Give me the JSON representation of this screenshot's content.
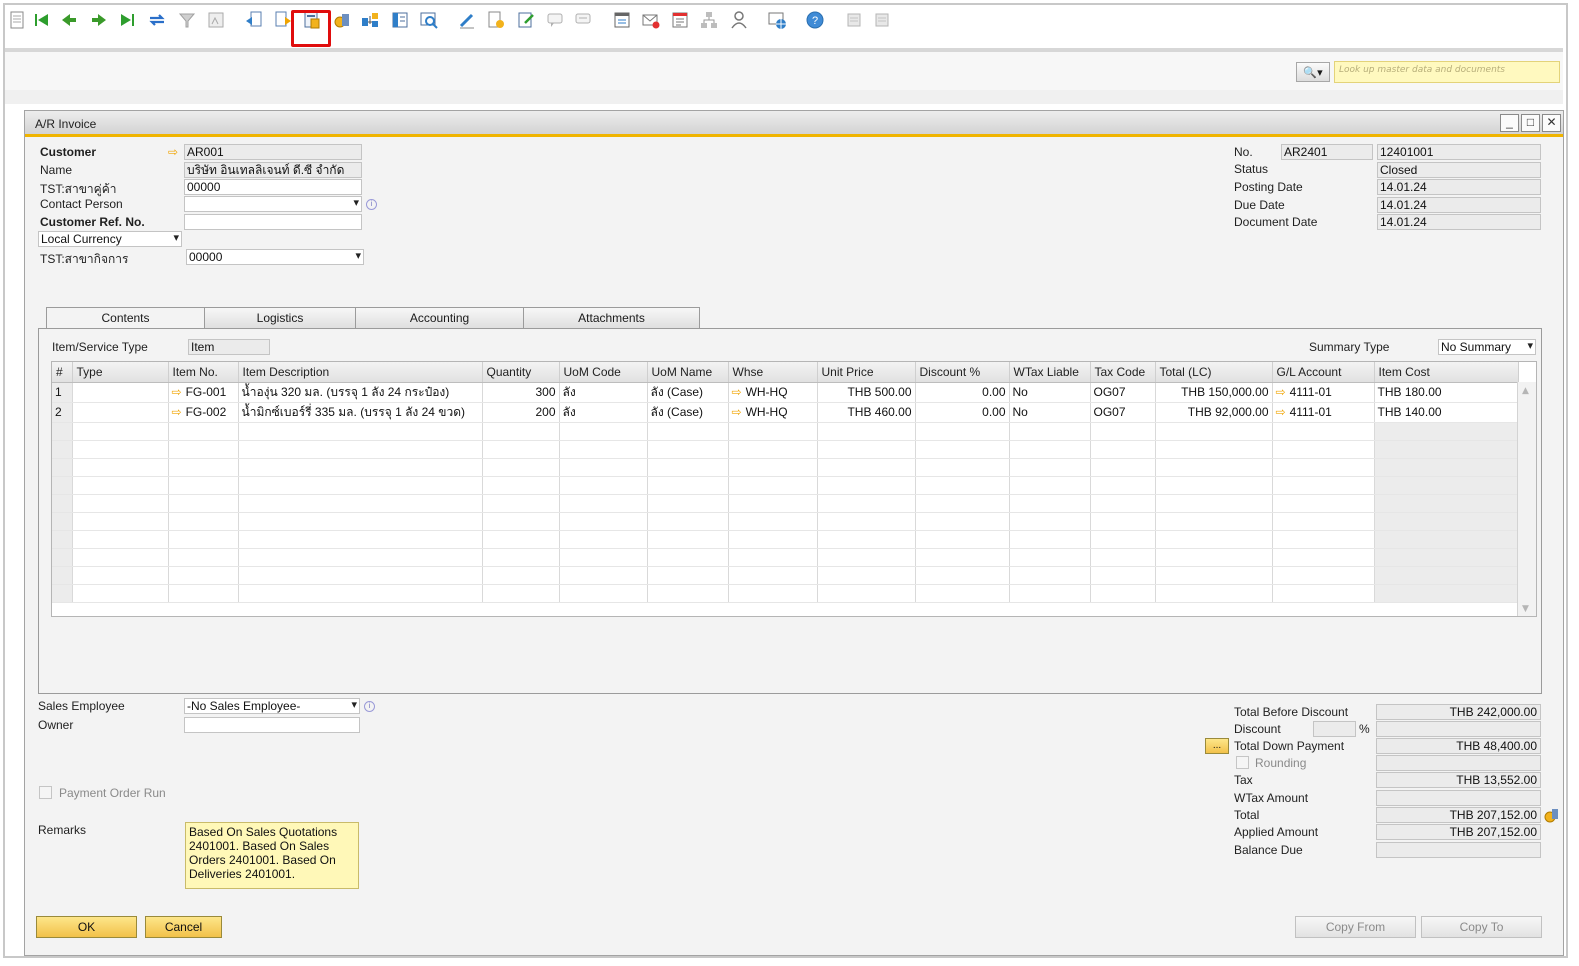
{
  "toolbar": {
    "icons": [
      "document-icon",
      "first-record-icon",
      "previous-record-icon",
      "next-record-icon",
      "last-record-icon",
      "refresh-icon",
      "filter-icon",
      "sort-icon",
      "base-document-icon",
      "target-document-icon",
      "gross-profit-icon",
      "payment-means-icon",
      "relationship-map-icon",
      "journal-entry-icon",
      "preview-icon",
      "edit-icon",
      "new-activity-icon",
      "approve-icon",
      "message-icon",
      "chat-icon",
      "calendar-icon",
      "email-icon",
      "report-icon",
      "org-chart-icon",
      "user-icon",
      "web-icon",
      "help-icon",
      "settings-icon",
      "print-icon"
    ],
    "marker": "1"
  },
  "search": {
    "placeholder": "Look up master data and documents",
    "button_icon": "🔍▾"
  },
  "window": {
    "title": "A/R Invoice",
    "minimize": "_",
    "maximize": "□",
    "close": "✕"
  },
  "header_left": {
    "customer_label": "Customer",
    "customer_value": "AR001",
    "name_label": "Name",
    "name_value": "บริษัท อินเทลลิเจนท์ ดี.ซี จำกัด",
    "branch_label": "TST:สาขาคู่ค้า",
    "branch_value": "00000",
    "contact_label": "Contact Person",
    "contact_value": "",
    "ref_label": "Customer Ref. No.",
    "ref_value": "",
    "currency_value": "Local Currency",
    "bizbranch_label": "TST:สาขากิจการ",
    "bizbranch_value": "00000"
  },
  "header_right": {
    "no_label": "No.",
    "no_series": "AR2401",
    "no_value": "12401001",
    "status_label": "Status",
    "status_value": "Closed",
    "posting_label": "Posting Date",
    "posting_value": "14.01.24",
    "due_label": "Due Date",
    "due_value": "14.01.24",
    "docdate_label": "Document Date",
    "docdate_value": "14.01.24"
  },
  "tabs": [
    "Contents",
    "Logistics",
    "Accounting",
    "Attachments"
  ],
  "contents": {
    "type_label": "Item/Service Type",
    "type_value": "Item",
    "summary_label": "Summary Type",
    "summary_value": "No Summary",
    "columns": [
      "#",
      "Type",
      "Item No.",
      "Item Description",
      "Quantity",
      "UoM Code",
      "UoM Name",
      "Whse",
      "Unit Price",
      "Discount %",
      "WTax Liable",
      "Tax Code",
      "Total (LC)",
      "G/L Account",
      "Item Cost"
    ],
    "rows": [
      [
        "1",
        "",
        "FG-001",
        "น้ำองุ่น 320 มล. (บรรจุ 1 ลัง 24 กระป๋อง)",
        "300",
        "ลัง",
        "ลัง (Case)",
        "WH-HQ",
        "THB 500.00",
        "0.00",
        "No",
        "OG07",
        "THB 150,000.00",
        "4111-01",
        "THB 180.00"
      ],
      [
        "2",
        "",
        "FG-002",
        "น้ำมิกซ์เบอร์รี่ 335 มล. (บรรจุ 1 ลัง 24 ขวด)",
        "200",
        "ลัง",
        "ลัง (Case)",
        "WH-HQ",
        "THB 460.00",
        "0.00",
        "No",
        "OG07",
        "THB 92,000.00",
        "4111-01",
        "THB 140.00"
      ]
    ]
  },
  "footer_left": {
    "sales_emp_label": "Sales Employee",
    "sales_emp_value": "-No Sales Employee-",
    "owner_label": "Owner",
    "owner_value": "",
    "payment_run_label": "Payment Order Run",
    "remarks_label": "Remarks",
    "remarks_value": "Based On Sales Quotations 2401001. Based On Sales Orders 2401001. Based On Deliveries 2401001."
  },
  "footer_right": {
    "tbd_label": "Total Before Discount",
    "tbd_value": "THB 242,000.00",
    "discount_label": "Discount",
    "discount_pct": "",
    "discount_pct_sign": "%",
    "discount_value": "",
    "tdp_label": "Total Down Payment",
    "tdp_value": "THB 48,400.00",
    "tdp_button": "...",
    "rounding_label": "Rounding",
    "rounding_value": "",
    "tax_label": "Tax",
    "tax_value": "THB 13,552.00",
    "wtax_label": "WTax Amount",
    "wtax_value": "",
    "total_label": "Total",
    "total_value": "THB 207,152.00",
    "applied_label": "Applied Amount",
    "applied_value": "THB 207,152.00",
    "balance_label": "Balance Due",
    "balance_value": ""
  },
  "buttons": {
    "ok": "OK",
    "cancel": "Cancel",
    "copy_from": "Copy From",
    "copy_to": "Copy To"
  }
}
